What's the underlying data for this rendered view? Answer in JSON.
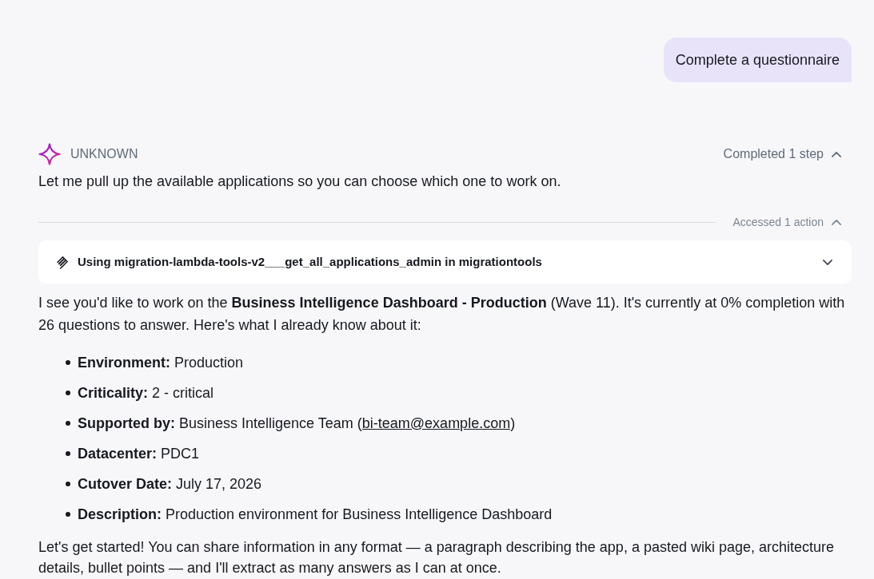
{
  "user_message": {
    "text": "Complete a questionnaire"
  },
  "assistant": {
    "name": "UNKNOWN",
    "steps_toggle": {
      "label": "Completed 1 step",
      "expanded": true
    },
    "intro": "Let me pull up the available applications so you can choose which one to work on.",
    "actions_toggle": {
      "label": "Accessed 1 action",
      "expanded": true
    },
    "tool_call": {
      "label": "Using migration-lambda-tools-v2___get_all_applications_admin in migrationtools",
      "expanded": false
    },
    "summary": "I see you'd like to work on the **Business Intelligence Dashboard - Production** (Wave 11). It's currently at 0% completion with 26 questions to answer. Here's what I already know about it:",
    "details": [
      {
        "label": "Environment:",
        "value": "Production"
      },
      {
        "label": "Criticality:",
        "value": "2 - critical"
      },
      {
        "label": "Supported by:",
        "value": "Business Intelligence Team (",
        "link": "bi-team@example.com",
        "value_after": ")"
      },
      {
        "label": "Datacenter:",
        "value": "PDC1"
      },
      {
        "label": "Cutover Date:",
        "value": "July 17, 2026"
      },
      {
        "label": "Description:",
        "value": "Production environment for Business Intelligence Dashboard"
      }
    ],
    "closing": "Let's get started! You can share information in any format — a paragraph describing the app, a pasted wiki page, architecture details, bullet points — and I'll extract as many answers as I can at once."
  }
}
